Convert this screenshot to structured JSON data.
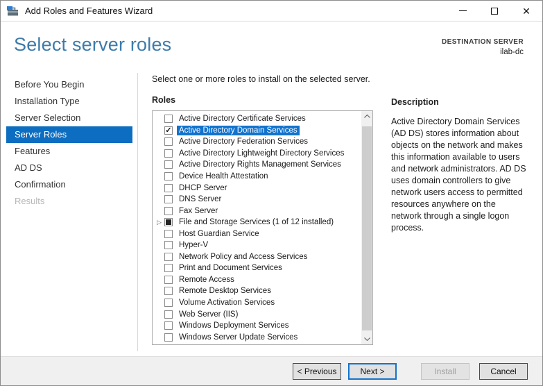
{
  "window": {
    "title": "Add Roles and Features Wizard"
  },
  "icons": {
    "app": "server-manager-toolbox",
    "minimize_glyph": "–",
    "close_glyph": "✕",
    "expander_glyph": "▷",
    "checkmark_glyph": "✓"
  },
  "header": {
    "page_title": "Select server roles",
    "destination_label": "DESTINATION SERVER",
    "destination_value": "ilab-dc"
  },
  "sidebar": {
    "items": [
      {
        "label": "Before You Begin",
        "state": "normal"
      },
      {
        "label": "Installation Type",
        "state": "normal"
      },
      {
        "label": "Server Selection",
        "state": "normal"
      },
      {
        "label": "Server Roles",
        "state": "selected"
      },
      {
        "label": "Features",
        "state": "normal"
      },
      {
        "label": "AD DS",
        "state": "normal"
      },
      {
        "label": "Confirmation",
        "state": "normal"
      },
      {
        "label": "Results",
        "state": "disabled"
      }
    ]
  },
  "main": {
    "instruction": "Select one or more roles to install on the selected server.",
    "roles_label": "Roles",
    "roles": [
      {
        "label": "Active Directory Certificate Services",
        "checked": false,
        "selected": false,
        "expandable": false
      },
      {
        "label": "Active Directory Domain Services",
        "checked": true,
        "selected": true,
        "expandable": false
      },
      {
        "label": "Active Directory Federation Services",
        "checked": false,
        "selected": false,
        "expandable": false
      },
      {
        "label": "Active Directory Lightweight Directory Services",
        "checked": false,
        "selected": false,
        "expandable": false
      },
      {
        "label": "Active Directory Rights Management Services",
        "checked": false,
        "selected": false,
        "expandable": false
      },
      {
        "label": "Device Health Attestation",
        "checked": false,
        "selected": false,
        "expandable": false
      },
      {
        "label": "DHCP Server",
        "checked": false,
        "selected": false,
        "expandable": false
      },
      {
        "label": "DNS Server",
        "checked": false,
        "selected": false,
        "expandable": false
      },
      {
        "label": "Fax Server",
        "checked": false,
        "selected": false,
        "expandable": false
      },
      {
        "label": "File and Storage Services (1 of 12 installed)",
        "checked": "partial",
        "selected": false,
        "expandable": true
      },
      {
        "label": "Host Guardian Service",
        "checked": false,
        "selected": false,
        "expandable": false
      },
      {
        "label": "Hyper-V",
        "checked": false,
        "selected": false,
        "expandable": false
      },
      {
        "label": "Network Policy and Access Services",
        "checked": false,
        "selected": false,
        "expandable": false
      },
      {
        "label": "Print and Document Services",
        "checked": false,
        "selected": false,
        "expandable": false
      },
      {
        "label": "Remote Access",
        "checked": false,
        "selected": false,
        "expandable": false
      },
      {
        "label": "Remote Desktop Services",
        "checked": false,
        "selected": false,
        "expandable": false
      },
      {
        "label": "Volume Activation Services",
        "checked": false,
        "selected": false,
        "expandable": false
      },
      {
        "label": "Web Server (IIS)",
        "checked": false,
        "selected": false,
        "expandable": false
      },
      {
        "label": "Windows Deployment Services",
        "checked": false,
        "selected": false,
        "expandable": false
      },
      {
        "label": "Windows Server Update Services",
        "checked": false,
        "selected": false,
        "expandable": false
      }
    ]
  },
  "description": {
    "title": "Description",
    "body": "Active Directory Domain Services (AD DS) stores information about objects on the network and makes this information available to users and network administrators. AD DS uses domain controllers to give network users access to permitted resources anywhere on the network through a single logon process."
  },
  "footer": {
    "buttons": [
      {
        "label": "< Previous",
        "state": "normal"
      },
      {
        "label": "Next >",
        "state": "focused"
      },
      {
        "label": "Install",
        "state": "disabled"
      },
      {
        "label": "Cancel",
        "state": "normal"
      }
    ]
  },
  "colors": {
    "nav_selected_bg": "#0d6dc0",
    "list_highlight_bg": "#1273cd",
    "heading_text": "#3d7bab",
    "footer_bg": "#f0f0f0",
    "focus_border": "#1273cd"
  }
}
